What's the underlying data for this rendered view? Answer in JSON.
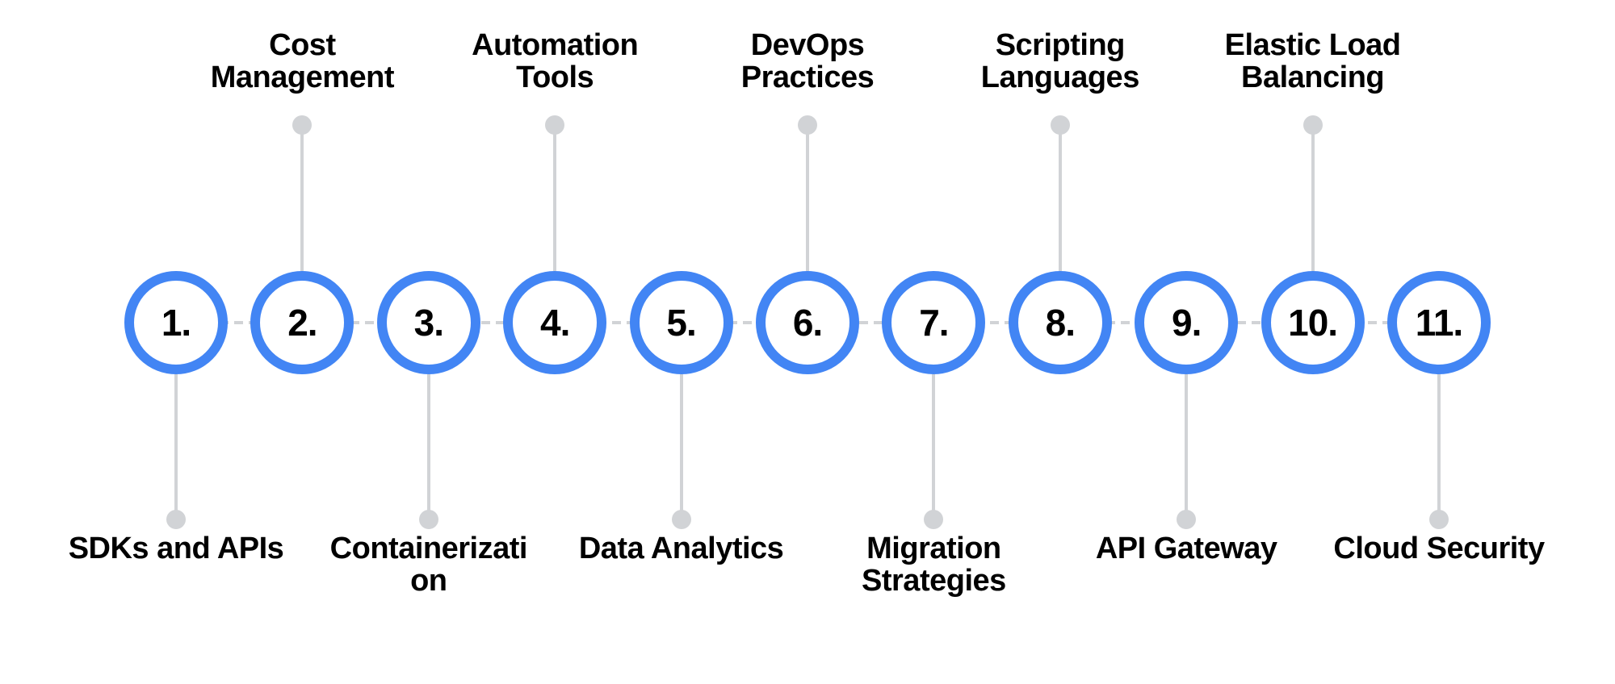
{
  "diagram": {
    "title": "",
    "accent_color": "#4285f4",
    "connector_color": "#d1d3d6",
    "steps": [
      {
        "number": "1.",
        "position": "below",
        "lines": [
          "SDKs and APIs"
        ]
      },
      {
        "number": "2.",
        "position": "above",
        "lines": [
          "Cost",
          "Management"
        ]
      },
      {
        "number": "3.",
        "position": "below",
        "lines": [
          "Containerizati",
          "on"
        ]
      },
      {
        "number": "4.",
        "position": "above",
        "lines": [
          "Automation",
          "Tools"
        ]
      },
      {
        "number": "5.",
        "position": "below",
        "lines": [
          "Data Analytics"
        ]
      },
      {
        "number": "6.",
        "position": "above",
        "lines": [
          "DevOps",
          "Practices"
        ]
      },
      {
        "number": "7.",
        "position": "below",
        "lines": [
          "Migration",
          "Strategies"
        ]
      },
      {
        "number": "8.",
        "position": "above",
        "lines": [
          "Scripting",
          "Languages"
        ]
      },
      {
        "number": "9.",
        "position": "below",
        "lines": [
          "API Gateway"
        ]
      },
      {
        "number": "10.",
        "position": "above",
        "lines": [
          "Elastic Load",
          "Balancing"
        ]
      },
      {
        "number": "11.",
        "position": "below",
        "lines": [
          "Cloud Security"
        ]
      }
    ]
  }
}
